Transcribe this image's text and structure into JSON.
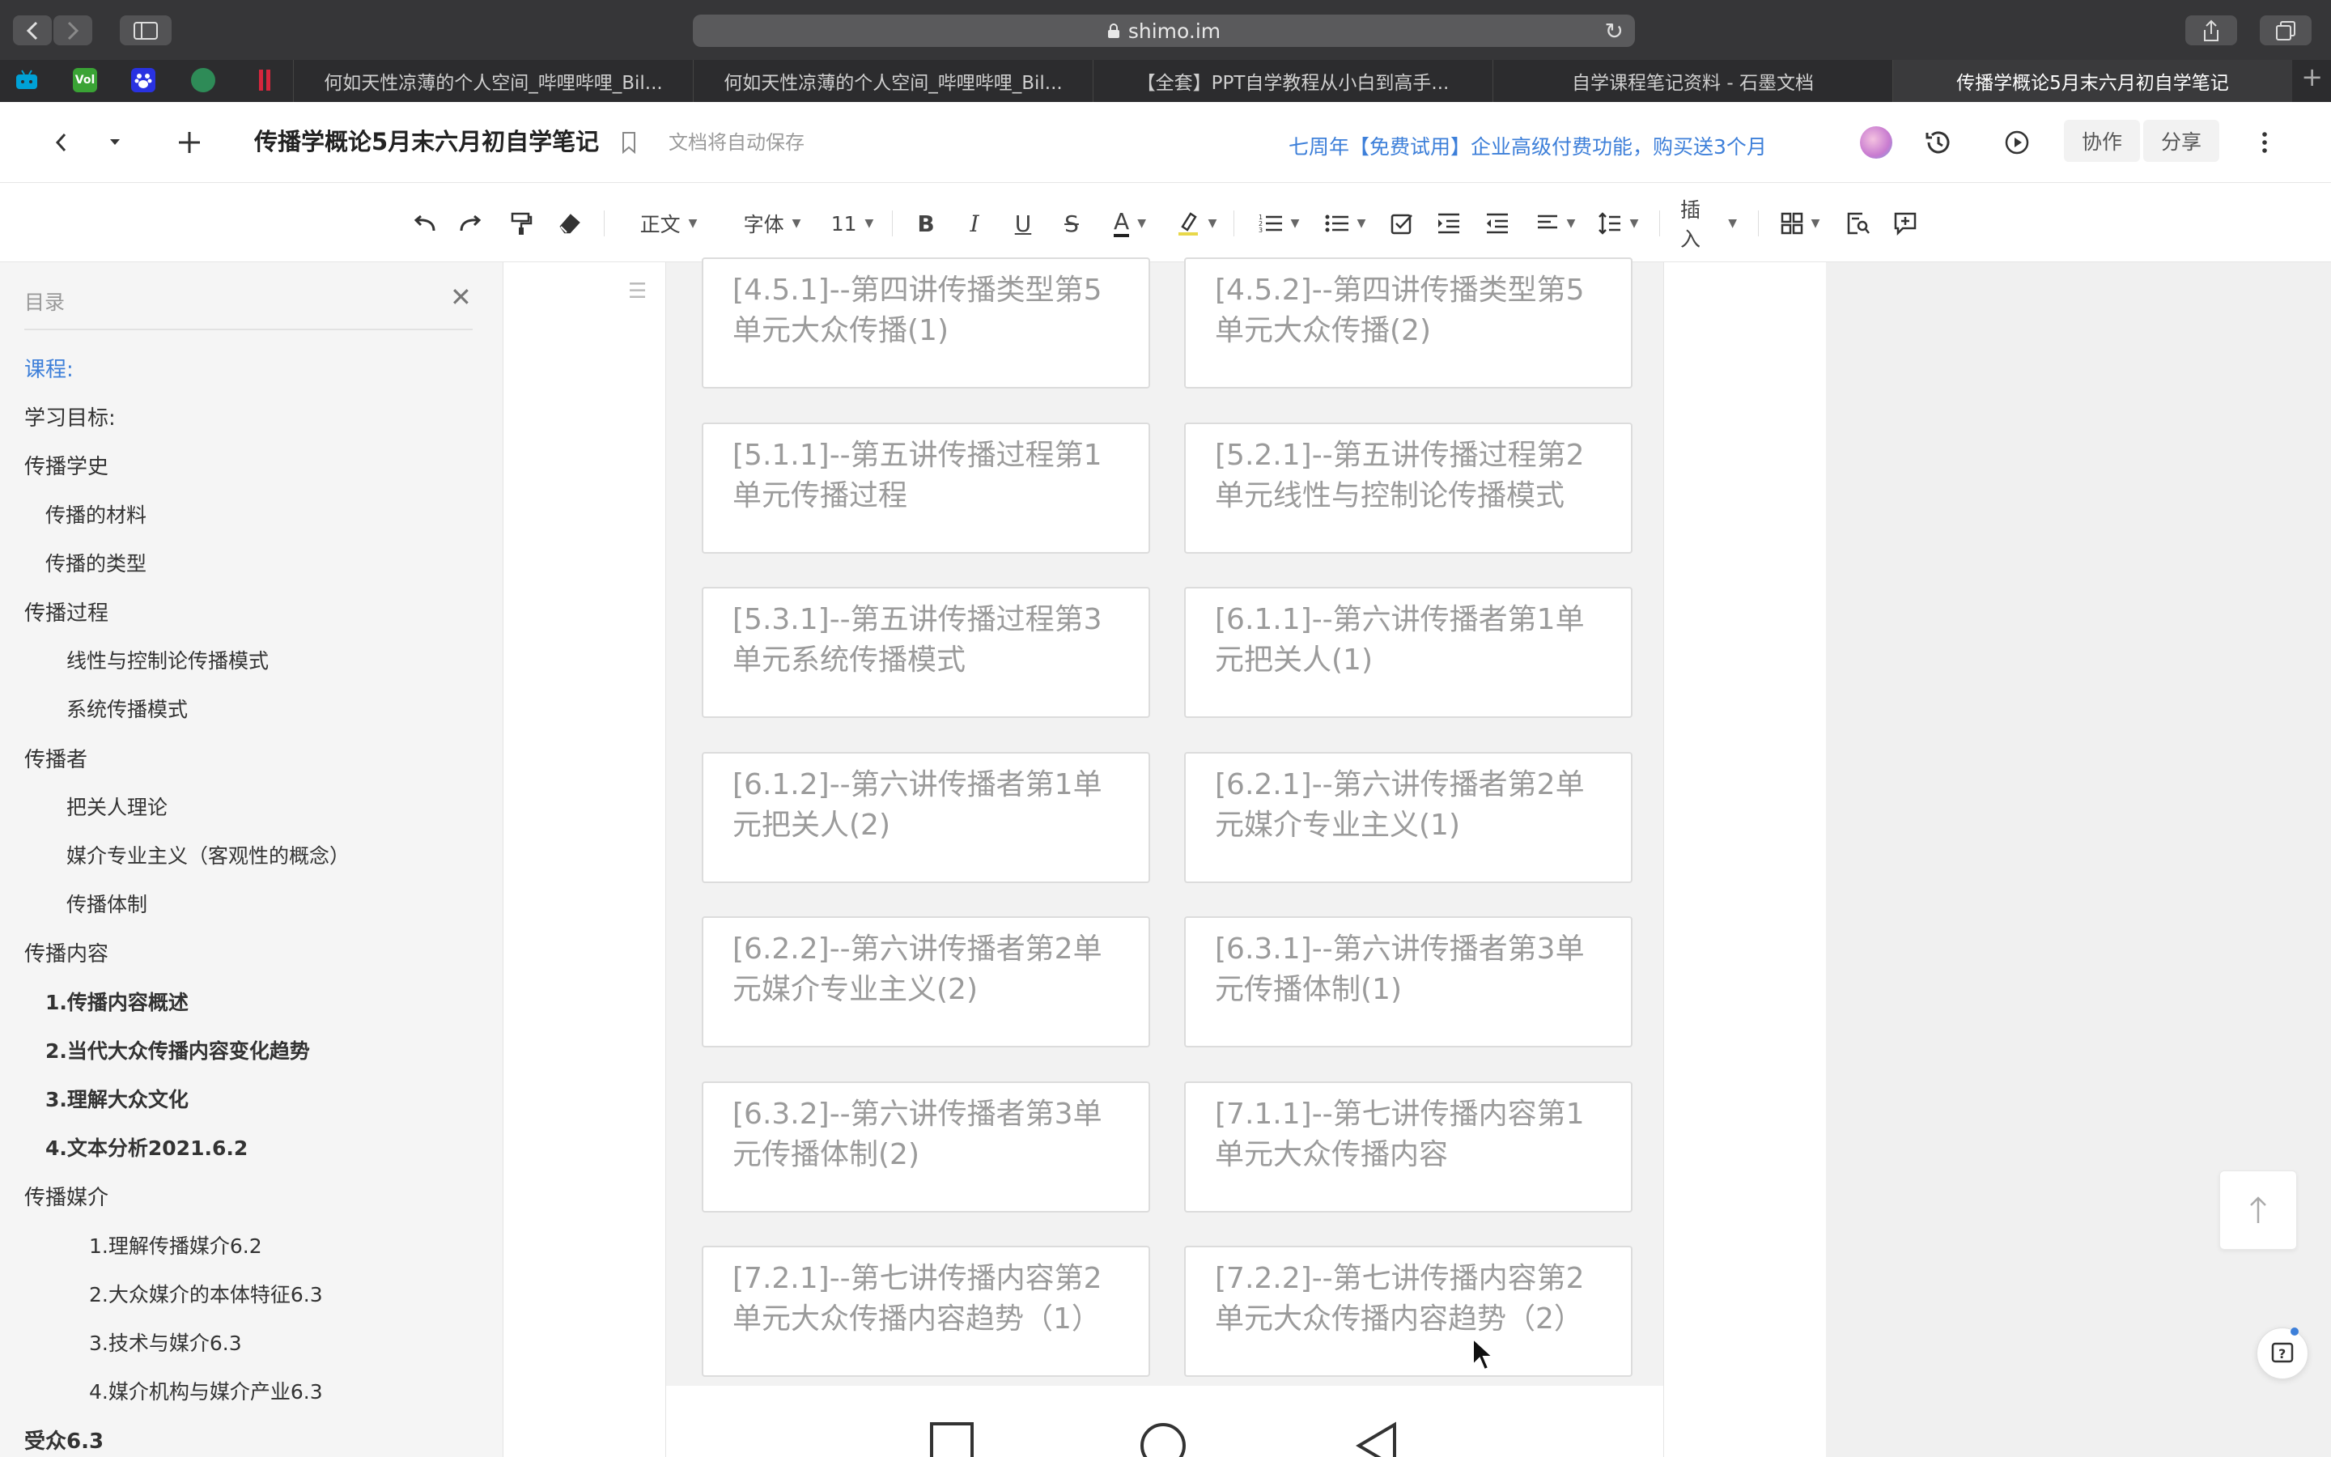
{
  "browser": {
    "url": "shimo.im",
    "tabs": [
      "何如天性凉薄的个人空间_哔哩哔哩_Bil...",
      "何如天性凉薄的个人空间_哔哩哔哩_Bil...",
      "【全套】PPT自学教程从小白到高手...",
      "自学课程笔记资料 - 石墨文档",
      "传播学概论5月末六月初自学笔记"
    ],
    "favicons": [
      {
        "name": "bilibili-tv-icon",
        "color": "#00a1d6",
        "label": ""
      },
      {
        "name": "vol-icon",
        "color": "#3aa335",
        "label": "Vol"
      },
      {
        "name": "baidu-icon",
        "color": "#2932e1",
        "label": ""
      },
      {
        "name": "green-app-icon",
        "color": "#2e8b57",
        "label": ""
      },
      {
        "name": "red-app-icon",
        "color": "#d7263d",
        "label": ""
      }
    ]
  },
  "header": {
    "title": "传播学概论5月末六月初自学笔记",
    "autosave": "文档将自动保存",
    "promo": "七周年【免费试用】企业高级付费功能，购买送3个月",
    "collab": "协作",
    "share": "分享"
  },
  "toolbar": {
    "style": "正文",
    "font": "字体",
    "size": "11",
    "bold": "B",
    "italic": "I",
    "underline": "U",
    "strike": "S",
    "color": "A",
    "insert": "插入"
  },
  "toc": {
    "heading": "目录",
    "items": [
      {
        "label": "课程:",
        "level": 1,
        "active": true,
        "bold": false
      },
      {
        "label": "学习目标:",
        "level": 1,
        "active": false,
        "bold": false
      },
      {
        "label": "传播学史",
        "level": 1,
        "active": false,
        "bold": false
      },
      {
        "label": "传播的材料",
        "level": 2,
        "active": false,
        "bold": false
      },
      {
        "label": "传播的类型",
        "level": 2,
        "active": false,
        "bold": false
      },
      {
        "label": "传播过程",
        "level": 1,
        "active": false,
        "bold": false
      },
      {
        "label": "线性与控制论传播模式",
        "level": 3,
        "active": false,
        "bold": false
      },
      {
        "label": "系统传播模式",
        "level": 3,
        "active": false,
        "bold": false
      },
      {
        "label": "传播者",
        "level": 1,
        "active": false,
        "bold": false
      },
      {
        "label": "把关人理论",
        "level": 3,
        "active": false,
        "bold": false
      },
      {
        "label": "媒介专业主义（客观性的概念）",
        "level": 3,
        "active": false,
        "bold": false
      },
      {
        "label": "传播体制",
        "level": 3,
        "active": false,
        "bold": false
      },
      {
        "label": "传播内容",
        "level": 1,
        "active": false,
        "bold": false
      },
      {
        "label": "1.传播内容概述",
        "level": 2,
        "active": false,
        "bold": true
      },
      {
        "label": "2.当代大众传播内容变化趋势",
        "level": 2,
        "active": false,
        "bold": true
      },
      {
        "label": "3.理解大众文化",
        "level": 2,
        "active": false,
        "bold": true
      },
      {
        "label": "4.文本分析2021.6.2",
        "level": 2,
        "active": false,
        "bold": true
      },
      {
        "label": "传播媒介",
        "level": 1,
        "active": false,
        "bold": false
      },
      {
        "label": "1.理解传播媒介6.2",
        "level": 4,
        "active": false,
        "bold": false
      },
      {
        "label": "2.大众媒介的本体特征6.3",
        "level": 4,
        "active": false,
        "bold": false
      },
      {
        "label": "3.技术与媒介6.3",
        "level": 4,
        "active": false,
        "bold": false
      },
      {
        "label": "4.媒介机构与媒介产业6.3",
        "level": 4,
        "active": false,
        "bold": false
      },
      {
        "label": "受众6.3",
        "level": 1,
        "active": false,
        "bold": true
      }
    ]
  },
  "cards": [
    {
      "line1": "[4.5.1]--第四讲传播类型第5",
      "line2": "单元大众传播(1)"
    },
    {
      "line1": "[4.5.2]--第四讲传播类型第5",
      "line2": "单元大众传播(2)"
    },
    {
      "line1": "[5.1.1]--第五讲传播过程第1",
      "line2": "单元传播过程"
    },
    {
      "line1": "[5.2.1]--第五讲传播过程第2",
      "line2": "单元线性与控制论传播模式"
    },
    {
      "line1": "[5.3.1]--第五讲传播过程第3",
      "line2": "单元系统传播模式"
    },
    {
      "line1": "[6.1.1]--第六讲传播者第1单",
      "line2": "元把关人(1)"
    },
    {
      "line1": "[6.1.2]--第六讲传播者第1单",
      "line2": "元把关人(2)"
    },
    {
      "line1": "[6.2.1]--第六讲传播者第2单",
      "line2": "元媒介专业主义(1)"
    },
    {
      "line1": "[6.2.2]--第六讲传播者第2单",
      "line2": "元媒介专业主义(2)"
    },
    {
      "line1": "[6.3.1]--第六讲传播者第3单",
      "line2": "元传播体制(1)"
    },
    {
      "line1": "[6.3.2]--第六讲传播者第3单",
      "line2": "元传播体制(2)"
    },
    {
      "line1": "[7.1.1]--第七讲传播内容第1",
      "line2": "单元大众传播内容"
    },
    {
      "line1": "[7.2.1]--第七讲传播内容第2",
      "line2": "单元大众传播内容趋势（1）"
    },
    {
      "line1": "[7.2.2]--第七讲传播内容第2",
      "line2": "单元大众传播内容趋势（2）"
    }
  ],
  "colors": {
    "accent": "#3d7fd9",
    "card_text": "#9b9b9b"
  }
}
